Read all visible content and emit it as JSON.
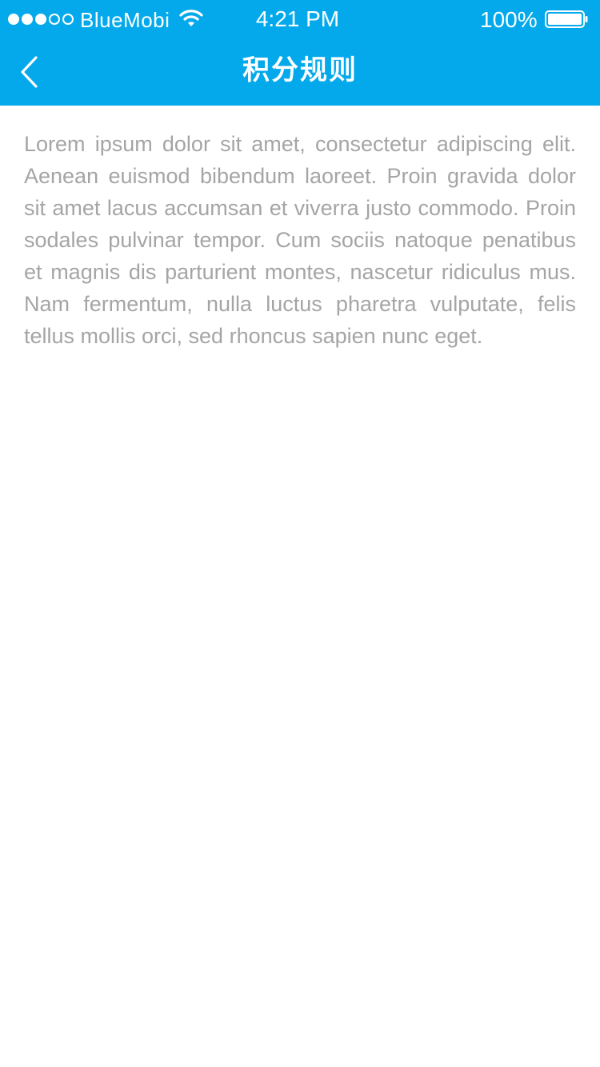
{
  "status_bar": {
    "carrier": "BlueMobi",
    "time": "4:21 PM",
    "battery": "100%",
    "signal_level": 3,
    "signal_max": 5,
    "battery_level": 1.0
  },
  "nav": {
    "title": "积分规则",
    "back_icon": "chevron-left-icon"
  },
  "content": {
    "body": "Lorem ipsum dolor sit amet, consectetur adipiscing elit. Aenean euismod bibendum laoreet. Proin gravida dolor sit amet lacus accumsan et viverra justo commodo. Proin sodales pulvinar tempor. Cum sociis natoque penatibus et magnis dis parturient montes, nascetur ridiculus mus. Nam fermentum, nulla luctus pharetra vulputate, felis tellus mollis orci, sed rhoncus sapien nunc eget."
  },
  "colors": {
    "header_background": "#03a9eb",
    "header_text": "#ffffff",
    "body_text": "#a5a5a5",
    "page_background": "#ffffff"
  }
}
